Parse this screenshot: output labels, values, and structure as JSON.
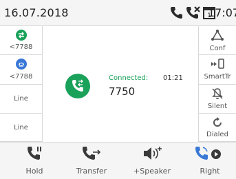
{
  "status_bar": {
    "date": "16.07.2018",
    "time": "17:07",
    "icons": [
      "phone-icon",
      "missed-call-icon",
      "calendar-icon"
    ]
  },
  "left_keys": [
    {
      "label": "<7788",
      "icon": "active-call-icon",
      "color": "#1aa15a"
    },
    {
      "label": "<7788",
      "icon": "held-call-icon",
      "color": "#3a78d6"
    },
    {
      "label": "Line"
    },
    {
      "label": "Line"
    }
  ],
  "right_keys": [
    {
      "label": "Conf",
      "icon": "conference-icon"
    },
    {
      "label": "SmartTr",
      "icon": "smart-transfer-icon"
    },
    {
      "label": "Silent",
      "icon": "bell-mute-icon"
    },
    {
      "label": "Dialed",
      "icon": "redial-icon"
    }
  ],
  "call": {
    "status": "Connected:",
    "duration": "01:21",
    "number": "7750",
    "accent": "#1aa15a"
  },
  "softkeys": [
    {
      "label": "Hold",
      "icon": "hold-icon"
    },
    {
      "label": "Transfer",
      "icon": "transfer-icon"
    },
    {
      "label": "+Speaker",
      "icon": "speaker-icon"
    },
    {
      "label": "Right",
      "icon": "right-nav-icon"
    }
  ]
}
